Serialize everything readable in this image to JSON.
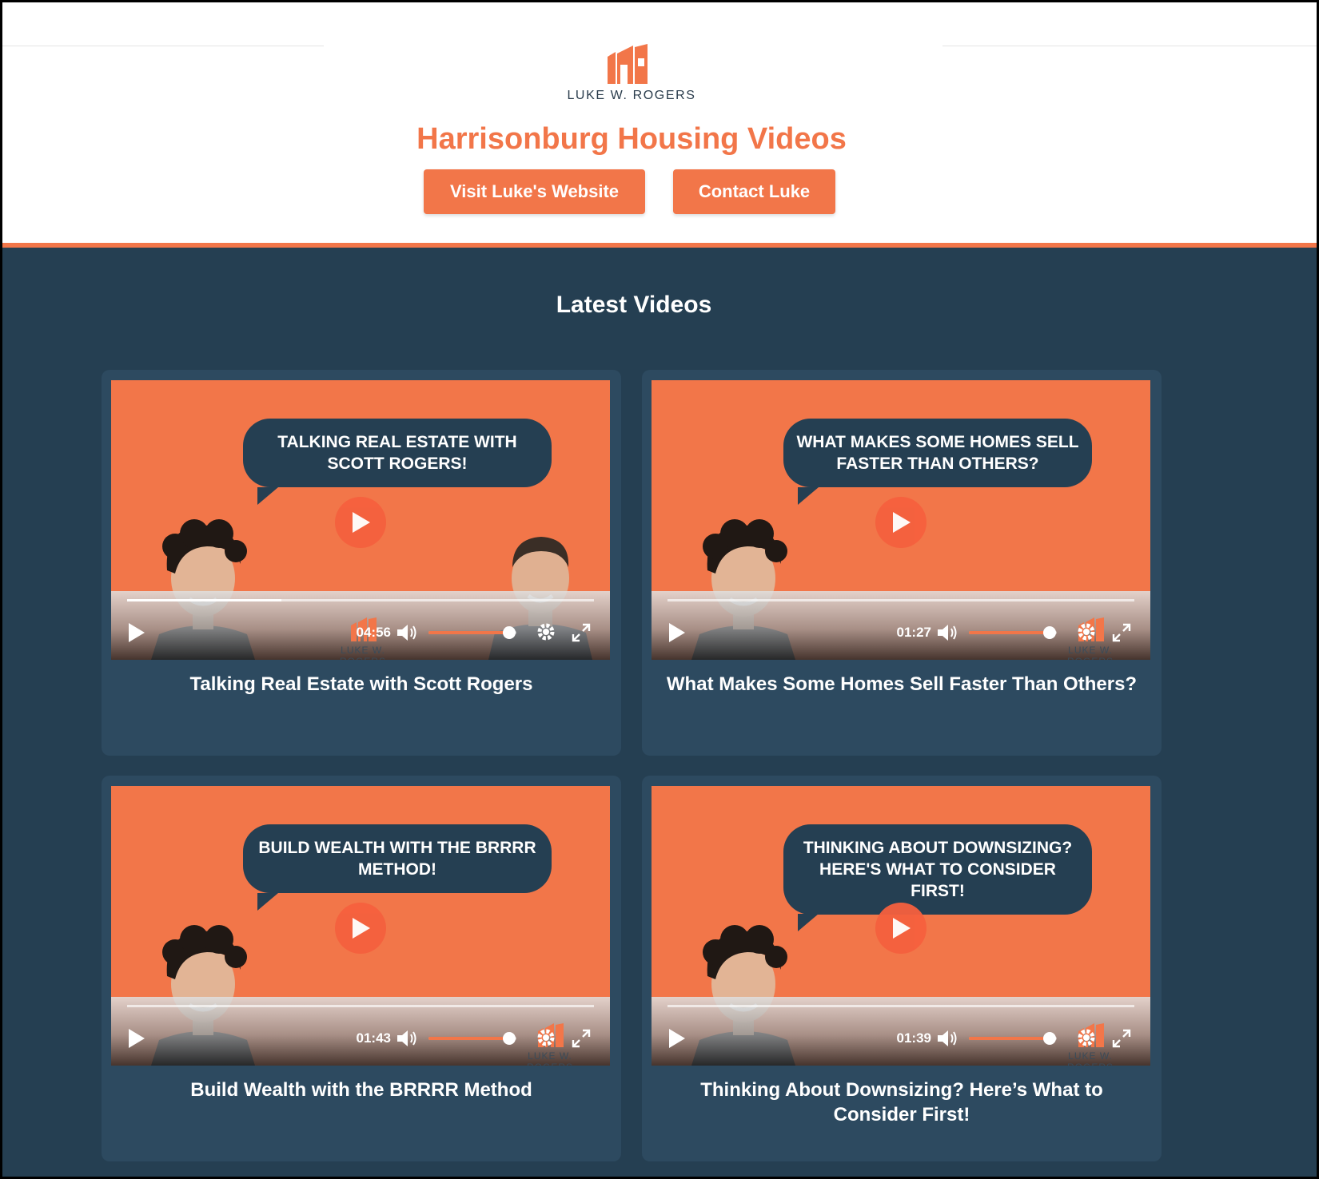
{
  "header": {
    "logo_text": "LUKE W. ROGERS",
    "title": "Harrisonburg Housing Videos",
    "website_button": "Visit Luke's Website",
    "contact_button": "Contact Luke"
  },
  "main": {
    "section_title": "Latest Videos",
    "videos": [
      {
        "thumbnail_text": "TALKING REAL ESTATE WITH SCOTT ROGERS!",
        "title": "Talking Real Estate with Scott Rogers",
        "duration": "04:56",
        "watermark": "LUKE W. ROGERS",
        "progress_fraction": 0.33,
        "volume_fraction": 0.92
      },
      {
        "thumbnail_text": "WHAT MAKES SOME HOMES SELL FASTER THAN OTHERS?",
        "title": "What Makes Some Homes Sell Faster Than Others?",
        "duration": "01:27",
        "watermark": "LUKE W. ROGERS",
        "progress_fraction": 0.0,
        "volume_fraction": 0.92
      },
      {
        "thumbnail_text": "BUILD WEALTH WITH THE BRRRR METHOD!",
        "title": "Build Wealth with the BRRRR Method",
        "duration": "01:43",
        "watermark": "LUKE W. ROGERS",
        "progress_fraction": 0.0,
        "volume_fraction": 0.92
      },
      {
        "thumbnail_text": "THINKING ABOUT DOWNSIZING? HERE'S WHAT TO CONSIDER FIRST!",
        "title": "Thinking About Downsizing? Here’s What to Consider First!",
        "duration": "01:39",
        "watermark": "LUKE W. ROGERS",
        "progress_fraction": 0.0,
        "volume_fraction": 0.92
      }
    ]
  },
  "colors": {
    "accent": "#f27649",
    "navy": "#253f52",
    "card": "#2d4a60"
  },
  "icons": [
    "building-logo-icon",
    "play-icon",
    "volume-icon",
    "settings-gear-icon",
    "fullscreen-icon"
  ]
}
